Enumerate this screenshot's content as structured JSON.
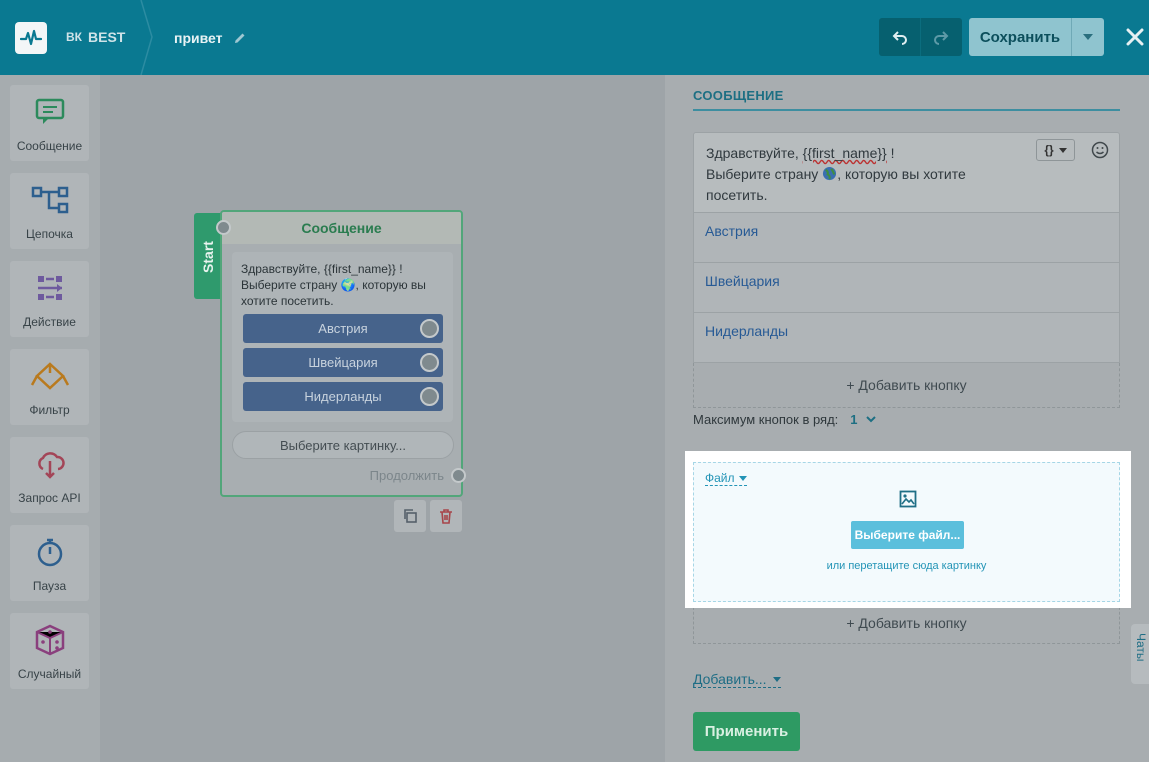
{
  "header": {
    "bot_network": "ВК",
    "bot_name": "BEST",
    "flow_name": "привет",
    "save_label": "Сохранить"
  },
  "toolbox": {
    "items": [
      {
        "label": "Сообщение",
        "icon": "message-icon"
      },
      {
        "label": "Цепочка",
        "icon": "chain-icon"
      },
      {
        "label": "Действие",
        "icon": "action-icon"
      },
      {
        "label": "Фильтр",
        "icon": "filter-icon"
      },
      {
        "label": "Запрос API",
        "icon": "api-request-icon"
      },
      {
        "label": "Пауза",
        "icon": "pause-icon"
      },
      {
        "label": "Случайный",
        "icon": "random-dice-icon"
      }
    ]
  },
  "node": {
    "start_label": "Start",
    "title": "Сообщение",
    "text": "Здравствуйте,  {{first_name}} ! Выберите страну 🌍, которую вы хотите посетить.",
    "buttons": [
      "Австрия",
      "Швейцария",
      "Нидерланды"
    ],
    "image_placeholder": "Выберите картинку...",
    "continue_label": "Продолжить"
  },
  "panel": {
    "title": "СООБЩЕНИЕ",
    "message_line1_prefix": "Здравствуйте,  ",
    "message_var": "{{first_name}}",
    "message_line1_suffix": " !",
    "message_line2_prefix": "Выберите страну ",
    "message_line2_suffix": ", которую вы хотите посетить.",
    "var_button": "{}",
    "choices": [
      "Австрия",
      "Швейцария",
      "Нидерланды"
    ],
    "add_button_label": "+ Добавить кнопку",
    "max_buttons_label": "Максимум кнопок в ряд:",
    "max_buttons_value": "1",
    "file_label": "Файл",
    "choose_file_label": "Выберите файл...",
    "drop_hint": "или перетащите сюда картинку",
    "add_button_label_2": "+ Добавить кнопку",
    "add_more_label": "Добавить...",
    "apply_label": "Применить",
    "chats_label": "Чаты"
  },
  "colors": {
    "topbar": "#0a7991",
    "accent_green": "#2e9a63",
    "file_button": "#5bbfdc"
  }
}
